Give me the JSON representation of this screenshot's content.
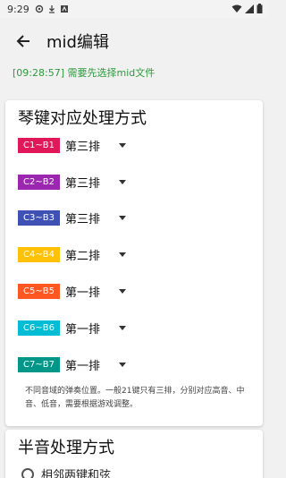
{
  "status_bar": {
    "time": "9:29"
  },
  "app_bar": {
    "title": "mid编辑"
  },
  "info": {
    "message": "[09:28:57] 需要先选择mid文件",
    "color": "#2e9a3e"
  },
  "key_section": {
    "title": "琴键对应处理方式",
    "rows": [
      {
        "range": "C1~B1",
        "value": "第三排",
        "color": "#e0185a"
      },
      {
        "range": "C2~B2",
        "value": "第三排",
        "color": "#9b27b0"
      },
      {
        "range": "C3~B3",
        "value": "第三排",
        "color": "#3f51b5"
      },
      {
        "range": "C4~B4",
        "value": "第二排",
        "color": "#ffc107"
      },
      {
        "range": "C5~B5",
        "value": "第一排",
        "color": "#ff5722"
      },
      {
        "range": "C6~B6",
        "value": "第一排",
        "color": "#00bcd4"
      },
      {
        "range": "C7~B7",
        "value": "第一排",
        "color": "#009688"
      }
    ],
    "note": "不同音域的弹奏位置。一般21键只有三排，分别对应高音、中音、低音，需要根据游戏调整。"
  },
  "semitone_section": {
    "title": "半音处理方式",
    "options": [
      {
        "label": "相邻两键和弦"
      }
    ]
  }
}
